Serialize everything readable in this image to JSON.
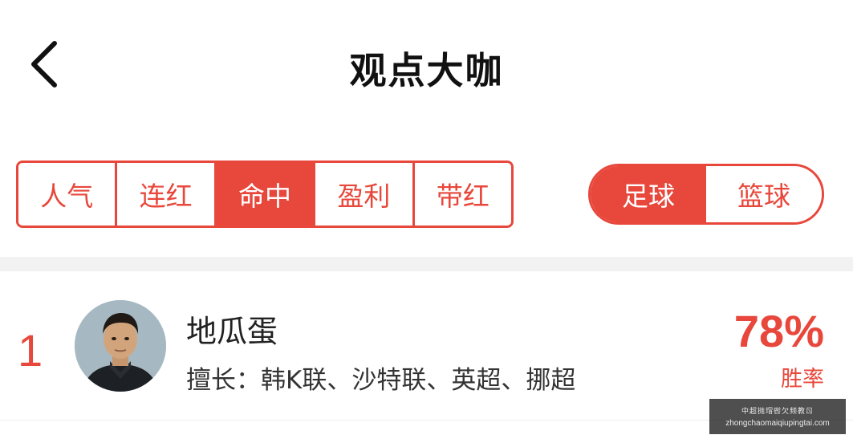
{
  "header": {
    "title": "观点大咖",
    "back_icon": "chevron-left-icon"
  },
  "rank_tabs": [
    {
      "label": "人气",
      "active": false
    },
    {
      "label": "连红",
      "active": false
    },
    {
      "label": "命中",
      "active": true
    },
    {
      "label": "盈利",
      "active": false
    },
    {
      "label": "带红",
      "active": false
    }
  ],
  "sport_toggle": [
    {
      "label": "足球",
      "active": true
    },
    {
      "label": "篮球",
      "active": false
    }
  ],
  "experts": [
    {
      "rank": "1",
      "name": "地瓜蛋",
      "specialty": "擅长：韩K联、沙特联、英超、挪超",
      "win_rate": "78%",
      "win_rate_label": "胜率"
    }
  ],
  "watermark": {
    "line1": "中超抛瑁辔欠频教ㄖ",
    "line2": "zhongchaomaiqiupingtai.com"
  },
  "colors": {
    "accent": "#e8473b",
    "band": "#f2f2f2"
  }
}
